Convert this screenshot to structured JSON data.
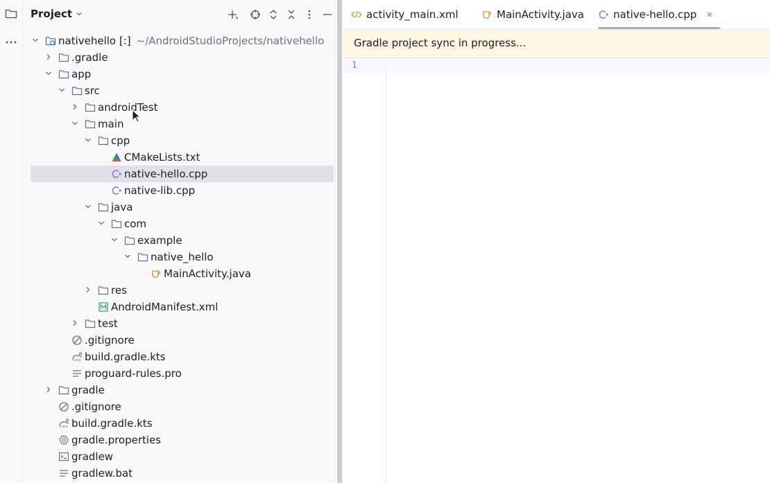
{
  "colors": {
    "accent": "#3574f0",
    "folder": "#6c707e",
    "cpp": "#9a6dd7",
    "java": "#e08a21",
    "manifest": "#3d9a50",
    "banner": "#fdf6e3"
  },
  "project_panel": {
    "title": "Project",
    "actions": [
      "plus-icon",
      "target-icon",
      "expand-all-icon",
      "collapse-all-icon",
      "more-vert-icon",
      "minimize-icon"
    ]
  },
  "tree": [
    {
      "depth": 0,
      "expanded": true,
      "icon": "module-folder-icon",
      "label": "nativehello [:]",
      "suffix": "~/AndroidStudioProjects/nativehello"
    },
    {
      "depth": 1,
      "expanded": false,
      "icon": "folder-icon",
      "label": ".gradle"
    },
    {
      "depth": 1,
      "expanded": true,
      "icon": "folder-icon",
      "label": "app"
    },
    {
      "depth": 2,
      "expanded": true,
      "icon": "folder-icon",
      "label": "src"
    },
    {
      "depth": 3,
      "expanded": false,
      "icon": "folder-icon",
      "label": "androidTest"
    },
    {
      "depth": 3,
      "expanded": true,
      "icon": "folder-icon",
      "label": "main"
    },
    {
      "depth": 4,
      "expanded": true,
      "icon": "folder-icon",
      "label": "cpp"
    },
    {
      "depth": 5,
      "icon": "cmake-icon",
      "label": "CMakeLists.txt"
    },
    {
      "depth": 5,
      "icon": "cpp-file-icon",
      "label": "native-hello.cpp",
      "selected": true
    },
    {
      "depth": 5,
      "icon": "cpp-file-icon",
      "label": "native-lib.cpp"
    },
    {
      "depth": 4,
      "expanded": true,
      "icon": "folder-icon",
      "label": "java"
    },
    {
      "depth": 5,
      "expanded": true,
      "icon": "folder-icon",
      "label": "com"
    },
    {
      "depth": 6,
      "expanded": true,
      "icon": "folder-icon",
      "label": "example"
    },
    {
      "depth": 7,
      "expanded": true,
      "icon": "folder-icon",
      "label": "native_hello"
    },
    {
      "depth": 8,
      "icon": "java-file-icon",
      "label": "MainActivity.java"
    },
    {
      "depth": 4,
      "expanded": false,
      "icon": "folder-icon",
      "label": "res"
    },
    {
      "depth": 4,
      "icon": "manifest-icon",
      "label": "AndroidManifest.xml"
    },
    {
      "depth": 3,
      "expanded": false,
      "icon": "folder-icon",
      "label": "test"
    },
    {
      "depth": 2,
      "icon": "gitignore-icon",
      "label": ".gitignore"
    },
    {
      "depth": 2,
      "icon": "gradle-file-icon",
      "label": "build.gradle.kts"
    },
    {
      "depth": 2,
      "icon": "text-file-icon",
      "label": "proguard-rules.pro"
    },
    {
      "depth": 1,
      "expanded": false,
      "icon": "folder-icon",
      "label": "gradle"
    },
    {
      "depth": 1,
      "icon": "gitignore-icon",
      "label": ".gitignore"
    },
    {
      "depth": 1,
      "icon": "gradle-file-icon",
      "label": "build.gradle.kts"
    },
    {
      "depth": 1,
      "icon": "gear-file-icon",
      "label": "gradle.properties"
    },
    {
      "depth": 1,
      "icon": "terminal-file-icon",
      "label": "gradlew"
    },
    {
      "depth": 1,
      "icon": "text-file-icon",
      "label": "gradlew.bat"
    }
  ],
  "tabs": [
    {
      "label": "activity_main.xml",
      "icon": "xml-file-icon"
    },
    {
      "label": "MainActivity.java",
      "icon": "java-file-icon"
    },
    {
      "label": "native-hello.cpp",
      "icon": "cpp-file-icon",
      "active": true
    }
  ],
  "editor": {
    "banner": "Gradle project sync in progress...",
    "line_numbers": [
      "1"
    ]
  }
}
